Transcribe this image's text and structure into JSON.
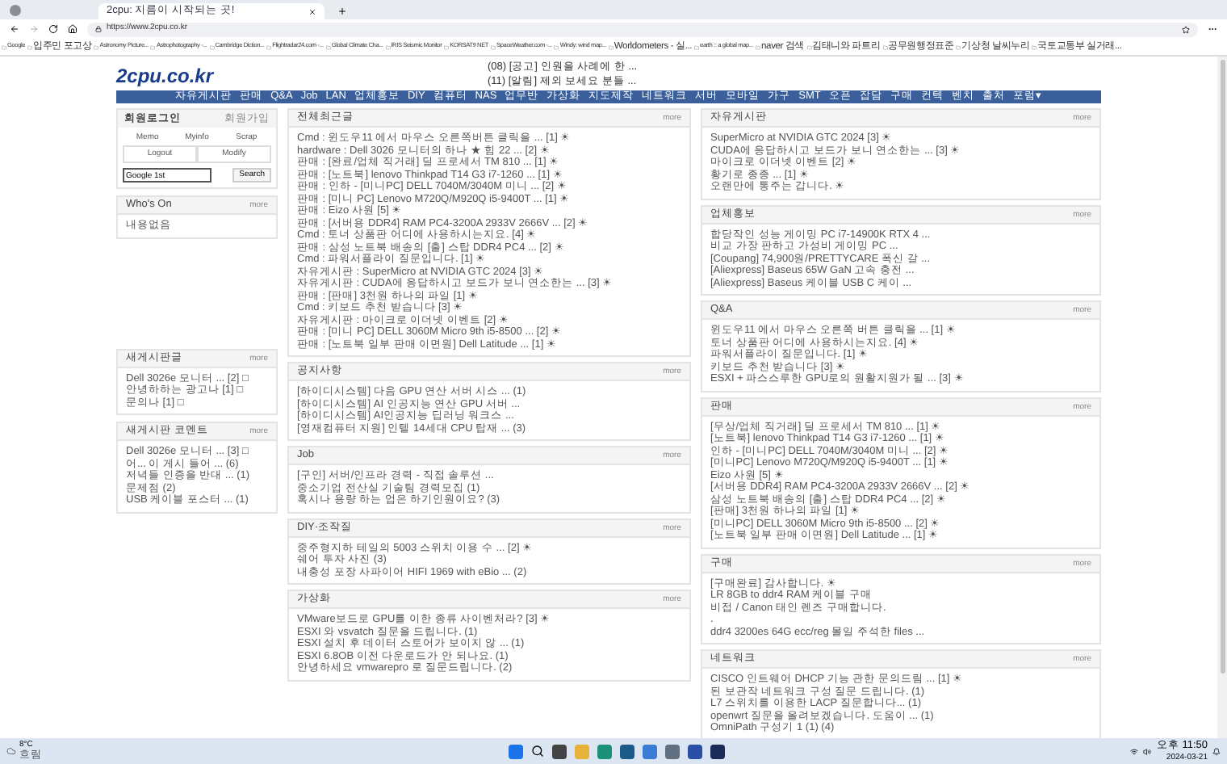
{
  "browser": {
    "tab_title": "2cpu: 지름이 시작되는 곳!",
    "url": "https://www.2cpu.co.kr",
    "bookmarks": [
      "Google",
      "입주민 포고상",
      "Astronomy Picture...",
      "Astrophotography -...",
      "Cambridge Diction...",
      "Flightradar24.com -...",
      "Global Climate Cha...",
      "IRIS Seismic Monitor",
      "KORSAT9 NET",
      "SpaceWeather.com -...",
      "Windy: wind map...",
      "Worldometers - 실...",
      "earth :: a global map...",
      "naver 검색",
      "김태니와 파트리",
      "공무원행정표준",
      "기상청 날씨누리",
      "국토교통부 실거래..."
    ]
  },
  "site": {
    "logo": "2cpu.co.kr",
    "notices": [
      "(08) [공고] 인원을 사례에 한 ...",
      "(11) [알림] 제외 보세요 분들 ..."
    ],
    "nav": [
      "자유게시판",
      "판매",
      "Q&A",
      "Job",
      "LAN",
      "업체홍보",
      "DIY",
      "컴퓨터",
      "NAS",
      "업무반",
      "가상화",
      "지도제작",
      "네트워크",
      "서버",
      "모바일",
      "가구",
      "SMT",
      "오픈",
      "잡담",
      "구매",
      "컨텍",
      "벤치",
      "출처",
      "포럼▾"
    ]
  },
  "login": {
    "title": "회원로그인",
    "link": "회원가입",
    "links": [
      "Memo",
      "Myinfo",
      "Scrap",
      "Logout",
      "Modify"
    ],
    "search_value": "Google 1st",
    "search_button": "Search"
  },
  "left": [
    {
      "title": "Who's On",
      "more": "more",
      "items": [
        "내용없음"
      ]
    },
    {
      "title": "새게시판글",
      "more": "more",
      "items": [
        "Dell 3026e 모니터 ... [2] □",
        "안녕하하는 광고나 [1] □",
        "문의나 [1] □"
      ]
    },
    {
      "title": "새게시판 코멘트",
      "more": "more",
      "items": [
        "Dell 3026e 모니터 ... [3] □",
        "어... 이 게시 들어 ... (6)",
        "저녁들 인증을 반대 ... (1)",
        "문제점 (2)",
        "USB 케이블 포스터 ... (1)"
      ]
    }
  ],
  "middle": [
    {
      "title": "전체최근글",
      "more": "more",
      "items": [
        "Cmd : 윈도우11 에서 마우스 오른쪽버튼 클릭을 ... [1] ☀",
        "hardware : Dell 3026 모니터의 하나 ★ 힘 22 ... [2] ☀",
        "판매 : [완료/업체 직거래] 딜 프로세서 TM 810 ... [1] ☀",
        "판매 : [노트북] lenovo Thinkpad T14 G3 i7-1260 ... [1] ☀",
        "판매 : 인하 - [미니PC] DELL 7040M/3040M 미니 ... [2] ☀",
        "판매 : [미니 PC] Lenovo M720Q/M920Q i5-9400T ... [1] ☀",
        "판매 : Eizo 사원 [5] ☀",
        "판매 : [서버용 DDR4] RAM PC4-3200A 2933V 2666V ... [2] ☀",
        "Cmd : 토너 상품판 어디에 사용하시는지요. [4] ☀",
        "판매 : 삼성 노트북 배송의 [출] 스탑 DDR4 PC4 ... [2] ☀",
        "Cmd : 파워서플라이 질문입니다. [1] ☀",
        "자유게시판 : SuperMicro at NVIDIA GTC 2024 [3] ☀",
        "자유게시판 : CUDA에 응답하시고 보드가 보니 연소한는 ... [3] ☀",
        "판매 : [판매] 3천원 하나의 파일 [1] ☀",
        "Cmd : 키보드 추천 받습니다 [3] ☀",
        "자유게시판 : 마이크로 이더넷 이벤트 [2] ☀",
        "판매 : [미니 PC] DELL 3060M Micro 9th i5-8500 ... [2] ☀",
        "판매 : [노트북 일부 판매 이면원] Dell Latitude ... [1] ☀"
      ]
    },
    {
      "title": "공지사항",
      "more": "more",
      "items": [
        "[하이디시스템] 다음 GPU 연산 서버 시스 ... (1)",
        "[하이디시스템] AI 인공지능 연산 GPU 서버 ...",
        "[하이디시스템] AI인공지능 딥러닝 워크스 ...",
        "[영재컴퓨터 지원] 인텔 14세대 CPU 탑재 ... (3)"
      ]
    },
    {
      "title": "Job",
      "more": "more",
      "items": [
        "[구인] 서버/인프라 경력 - 직접 솔루션 ...",
        "중소기업 전산실 기술팀 경력모집 (1)",
        "혹시나 용량 하는 업은 하기인원이요? (3)"
      ]
    },
    {
      "title": "DIY·조작질",
      "more": "more",
      "items": [
        "중주형지하 테일의 5003 스위치 이용 수 ... [2] ☀",
        "쉐어 투자 사진 (3)",
        "내충성 포장 사파이어 HIFI 1969 with eBio ... (2)"
      ]
    },
    {
      "title": "가상화",
      "more": "more",
      "items": [
        "VMware보드로 GPU를 이한 종류 사이벤처라? [3] ☀",
        "ESXI 와 vsvatch 질문을 드립니다. (1)",
        "ESXI 설치 후 데이터 스토어가 보이지 않 ... (1)",
        "ESXI 6.8OB 이전 다운로드가 안 되나요. (1)",
        "안녕하세요 vmwarepro 로 질문드립니다. (2)"
      ]
    }
  ],
  "right": [
    {
      "title": "자유게시판",
      "more": "more",
      "items": [
        "SuperMicro at NVIDIA GTC 2024 [3] ☀",
        "CUDA에 응답하시고 보드가 보니 연소한는 ... [3] ☀",
        "마이크로 이더넷 이벤트 [2] ☀",
        "황기로 종종 ... [1] ☀",
        "오랜만에 통주는 갑니다. ☀"
      ]
    },
    {
      "title": "업체홍보",
      "more": "more",
      "items": [
        "합당작인 성능 게이밍 PC i7-14900K RTX 4 ...",
        "비교 가장 판하고 가성비 게이밍 PC ...",
        "[Coupang] 74,900원/PRETTYCARE 폭신 갈 ...",
        "[Aliexpress] Baseus 65W GaN 고속 충전 ...",
        "[Aliexpress] Baseus 케이블 USB C 케이 ..."
      ]
    },
    {
      "title": "Q&A",
      "more": "more",
      "items": [
        "윈도우11 에서 마우스 오른쪽 버튼 클릭을 ... [1] ☀",
        "토너 상품판 어디에 사용하시는지요. [4] ☀",
        "파워서플라이 질문입니다. [1] ☀",
        "키보드 추천 받습니다 [3] ☀",
        "ESXI + 파스스루한 GPU로의 원활지원가 될 ... [3] ☀"
      ]
    },
    {
      "title": "판매",
      "more": "more",
      "items": [
        "[무상/업체 직거래] 딜 프로세서 TM 810 ... [1] ☀",
        "[노트북] lenovo Thinkpad T14 G3 i7-1260 ... [1] ☀",
        "인하 - [미니PC] DELL 7040M/3040M 미니 ... [2] ☀",
        "[미니PC] Lenovo M720Q/M920Q i5-9400T ... [1] ☀",
        "Eizo 사원 [5] ☀",
        "[서버용 DDR4] RAM PC4-3200A 2933V 2666V ... [2] ☀",
        "삼성 노트북 배송의 [출] 스탑 DDR4 PC4 ... [2] ☀",
        "[판매] 3천원 하나의 파일 [1] ☀",
        "[미니PC] DELL 3060M Micro 9th i5-8500 ... [2] ☀",
        "[노트북 일부 판매 이면원] Dell Latitude ... [1] ☀"
      ]
    },
    {
      "title": "구매",
      "more": "more",
      "items": [
        "[구매완료] 감사합니다. ☀",
        "LR 8GB to ddr4 RAM 케이블 구매",
        "비접 / Canon 태인 렌즈 구매합니다.",
        ".",
        "ddr4 3200es 64G ecc/reg 몰일 주석한 files ..."
      ]
    },
    {
      "title": "네트워크",
      "more": "more",
      "items": [
        "CISCO 인트웨어 DHCP 기능 관한 문의드림 ... [1] ☀",
        "된 보관작 네트워크 구성 질문 드립니다. (1)",
        "L7 스위치를 이용한 LACP 질문합니다... (1)",
        "openwrt 질문을 올려보겠습니다. 도움이 ... (1)",
        "OmniPath 구성기 1 (1) (4)"
      ]
    }
  ],
  "taskbar": {
    "temp": "8°C",
    "weather": "흐림",
    "time": "오후 11:50",
    "date": "2024-03-21"
  }
}
